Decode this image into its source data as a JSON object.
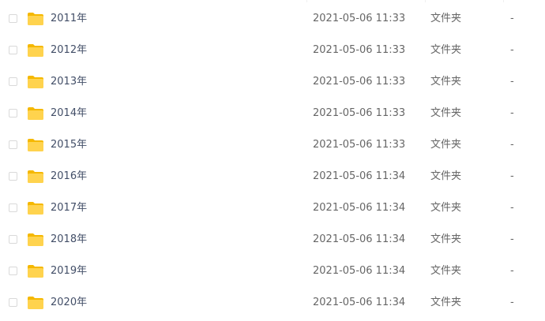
{
  "colors": {
    "folder": "#ffd34e",
    "folder_tab": "#f5b800",
    "text_name": "#424e67",
    "text_meta": "#666666"
  },
  "icons": {
    "row_icon": "folder-icon",
    "row_select": "checkbox"
  },
  "files": [
    {
      "name": "2011年",
      "modified": "2021-05-06 11:33",
      "type": "文件夹",
      "size": "-"
    },
    {
      "name": "2012年",
      "modified": "2021-05-06 11:33",
      "type": "文件夹",
      "size": "-"
    },
    {
      "name": "2013年",
      "modified": "2021-05-06 11:33",
      "type": "文件夹",
      "size": "-"
    },
    {
      "name": "2014年",
      "modified": "2021-05-06 11:33",
      "type": "文件夹",
      "size": "-"
    },
    {
      "name": "2015年",
      "modified": "2021-05-06 11:33",
      "type": "文件夹",
      "size": "-"
    },
    {
      "name": "2016年",
      "modified": "2021-05-06 11:34",
      "type": "文件夹",
      "size": "-"
    },
    {
      "name": "2017年",
      "modified": "2021-05-06 11:34",
      "type": "文件夹",
      "size": "-"
    },
    {
      "name": "2018年",
      "modified": "2021-05-06 11:34",
      "type": "文件夹",
      "size": "-"
    },
    {
      "name": "2019年",
      "modified": "2021-05-06 11:34",
      "type": "文件夹",
      "size": "-"
    },
    {
      "name": "2020年",
      "modified": "2021-05-06 11:34",
      "type": "文件夹",
      "size": "-"
    }
  ]
}
